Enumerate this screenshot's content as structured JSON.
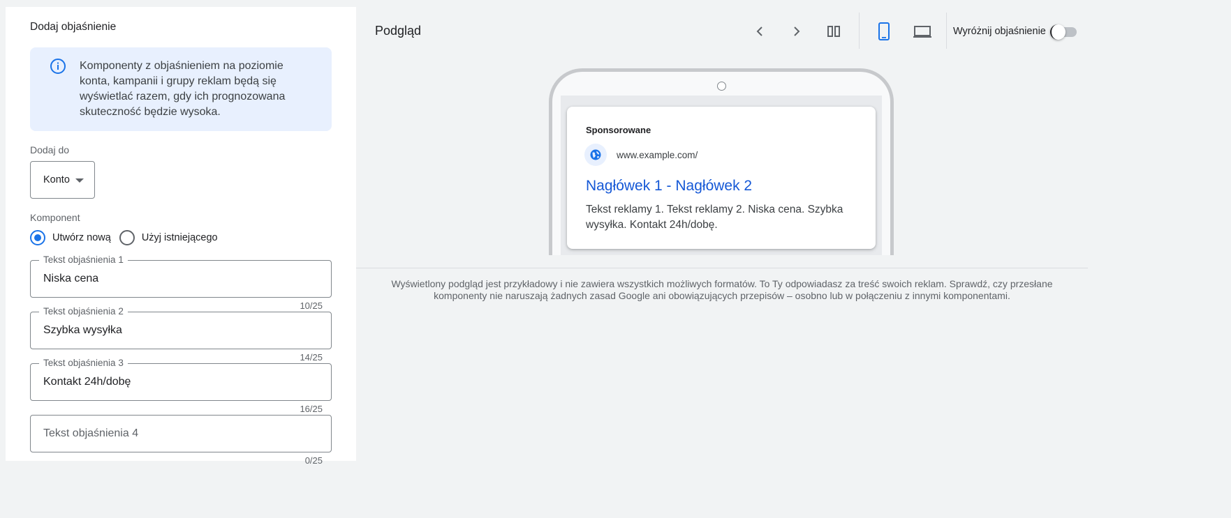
{
  "form": {
    "title": "Dodaj objaśnienie",
    "info_text": "Komponenty z objaśnieniem na poziomie konta, kampanii i grupy reklam będą się wyświetlać razem, gdy ich prognozowana skuteczność będzie wysoka.",
    "add_to_label": "Dodaj do",
    "add_to_value": "Konto",
    "component_label": "Komponent",
    "radio_options": [
      {
        "label": "Utwórz nową",
        "checked": true
      },
      {
        "label": "Użyj istniejącego",
        "checked": false
      }
    ],
    "fields": [
      {
        "label": "Tekst objaśnienia 1",
        "value": "Niska cena",
        "counter": "10/25"
      },
      {
        "label": "Tekst objaśnienia 2",
        "value": "Szybka wysyłka",
        "counter": "14/25"
      },
      {
        "label": "Tekst objaśnienia 3",
        "value": "Kontakt 24h/dobę",
        "counter": "16/25"
      },
      {
        "label": "",
        "placeholder": "Tekst objaśnienia 4",
        "value": "",
        "counter": "0/25"
      }
    ]
  },
  "preview": {
    "title": "Podgląd",
    "highlight_label": "Wyróżnij objaśnienie",
    "highlight_on": false,
    "toolbar_icons": [
      "chevron-left-icon",
      "chevron-right-icon",
      "split-view-icon",
      "mobile-icon",
      "desktop-icon"
    ],
    "active_device": "mobile",
    "ad": {
      "sponsored": "Sponsorowane",
      "url": "www.example.com/",
      "headline": "Nagłówek 1 - Nagłówek 2",
      "description": "Tekst reklamy 1. Tekst reklamy 2. Niska cena. Szybka wysyłka. Kontakt 24h/dobę."
    },
    "disclaimer": "Wyświetlony podgląd jest przykładowy i nie zawiera wszystkich możliwych formatów. To Ty odpowiadasz za treść swoich reklam. Sprawdź, czy przesłane komponenty nie naruszają żadnych zasad Google ani obowiązujących przepisów – osobno lub w połączeniu z innymi komponentami."
  },
  "colors": {
    "accent": "#1a73e8",
    "info_bg": "#e8f0fe",
    "headline_link": "#1558d6"
  }
}
